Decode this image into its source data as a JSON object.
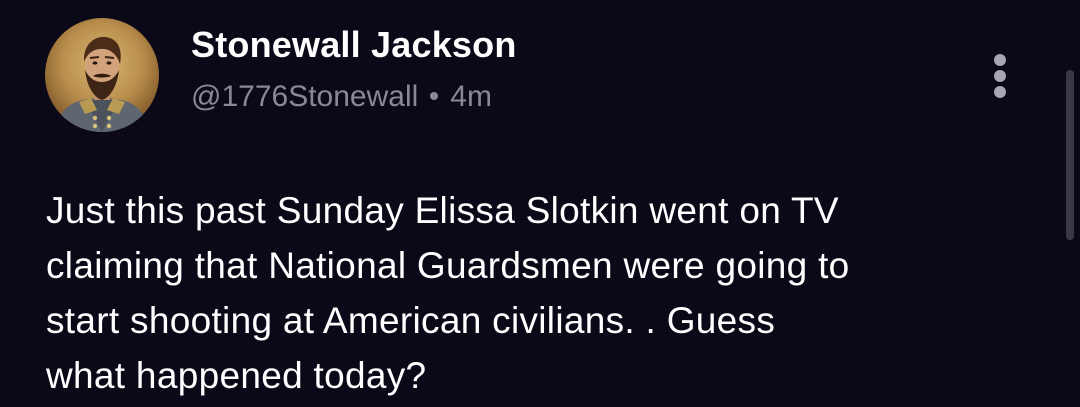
{
  "post": {
    "author": {
      "display_name": "Stonewall Jackson",
      "handle": "@1776Stonewall",
      "time_ago": "4m",
      "avatar_icon": "portrait-avatar"
    },
    "text": "Just this past Sunday Elissa Slotkin went on TV\nclaiming that National Guardsmen were going to\nstart shooting at American civilians. . Guess\nwhat happened today?",
    "more_icon": "more-vertical-icon"
  },
  "colors": {
    "background": "#0b0918",
    "text": "#ffffff",
    "meta_text": "#8a8896",
    "icon": "#a8a6b3"
  }
}
